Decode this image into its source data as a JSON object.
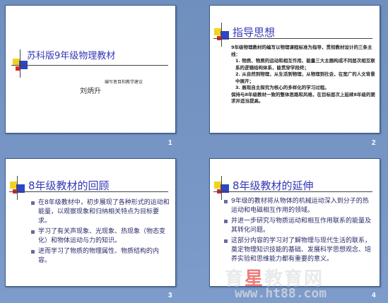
{
  "slides": [
    {
      "number": "1",
      "title": "苏科版9年级物理教材",
      "subtitle": "编写者目和教学建议",
      "author": "刘炳升"
    },
    {
      "number": "2",
      "title": "指导思想",
      "paragraphs": [
        "9年级物理教材的编写以物理课程标准为指导，贯彻教材设计的三条主线：",
        "1. 物质、物质的运动和相互作用、能量三大主题构成不同层次相互联系的逻辑结构体系，能贯穿学段终；",
        "2. 从自然到物理，从生活到物理，从物理到社会，在宽广的人文背景中展开；",
        "3. 展现自主探究为核心的多样化的学习过程。",
        "保持与8年级教材一致的整体思路和风格，在目标层次上延续8年级的要求并适当提高。"
      ]
    },
    {
      "number": "3",
      "title": "8年级教材的回顾",
      "bullets": [
        "在8年级教材中，初步展现了各种形式的运动和能量，以观察现象和归纳相关特点为目标要求。",
        "学习了有关声现象、光现象、热现象（物态变化）和物体运动与力的知识。",
        "进而学习了物质的物理属性、物质结构的内容。"
      ]
    },
    {
      "number": "4",
      "title": "8年级教材的延伸",
      "bullets": [
        "9年级的教材将从物体的机械运动深入到分子的热运动和电磁相互作用的领域。",
        "并进一步研究与物质运动和相互作用联系的能量及其转化问题。",
        "这部分内容的学习对了解物理与现代生活的联系，奠定物理知识技能的基础、发展科学思想观念、培养实验和思维能力都有重要的意义。"
      ]
    }
  ],
  "watermark": {
    "text_main": "育",
    "text_accent": "星",
    "text_rest": "教育网",
    "url": "www.ht88.com"
  },
  "colors": {
    "background": "#7d9bcb",
    "title": "#3538b7",
    "square_blue": "#2d45c8",
    "square_yellow": "#f3d21b",
    "square_red": "#d62a2a"
  }
}
